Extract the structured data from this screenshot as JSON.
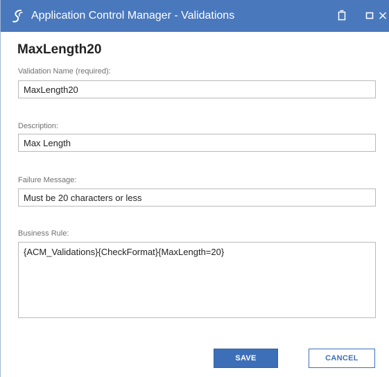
{
  "window": {
    "title": "Application Control Manager - Validations",
    "icons": [
      "app-logo-icon",
      "restore-icon",
      "maximize-icon",
      "close-icon"
    ],
    "accent_color": "#4a78bd"
  },
  "form": {
    "heading": "MaxLength20",
    "name_label": "Validation Name (required):",
    "name_value": "MaxLength20",
    "description_label": "Description:",
    "description_value": "Max Length",
    "failure_label": "Failure Message:",
    "failure_value": "Must be 20 characters or less",
    "rule_label": "Business Rule:",
    "rule_value": "{ACM_Validations}{CheckFormat}{MaxLength=20}"
  },
  "buttons": {
    "save_label": "SAVE",
    "cancel_label": "CANCEL",
    "primary_color": "#3d6fb8"
  }
}
